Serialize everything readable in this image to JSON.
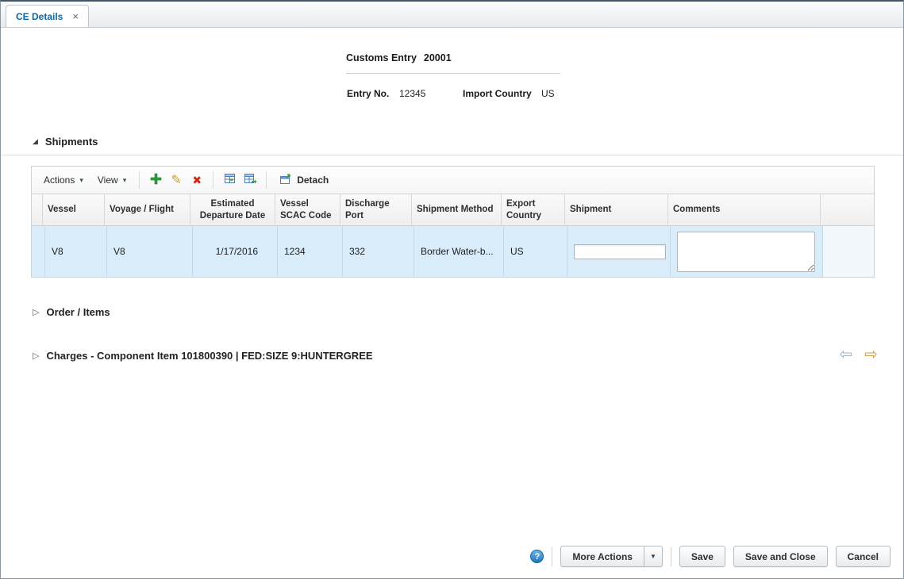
{
  "tab_bar": {
    "active_tab": {
      "label": "CE Details"
    }
  },
  "icons": {
    "tab_close": "×",
    "caret_down": "▾",
    "menu_caret": "▼",
    "expanded_triangle": "◢",
    "collapsed_triangle": "▷",
    "pencil": "✎",
    "delete_x": "✖",
    "prev_arrow": "⇦",
    "next_arrow": "⇨",
    "help": "?"
  },
  "header": {
    "title_label": "Customs Entry",
    "title_value": "20001",
    "entry_no_label": "Entry No.",
    "entry_no_value": "12345",
    "import_country_label": "Import Country",
    "import_country_value": "US"
  },
  "shipments": {
    "title": "Shipments",
    "toolbar": {
      "actions": "Actions",
      "view": "View",
      "detach": "Detach"
    },
    "columns": [
      "Vessel",
      "Voyage / Flight",
      "Estimated Departure Date",
      "Vessel SCAC Code",
      "Discharge Port",
      "Shipment Method",
      "Export Country",
      "Shipment",
      "Comments"
    ],
    "row": {
      "vessel": "V8",
      "voyage_flight": "V8",
      "estimated_departure_date": "1/17/2016",
      "vessel_scac_code": "1234",
      "discharge_port": "332",
      "shipment_method": "Border Water-b...",
      "export_country": "US",
      "shipment_value": "",
      "comments_value": ""
    }
  },
  "sections": {
    "order_items_title": "Order / Items",
    "charges_title": "Charges - Component Item 101800390 | FED:SIZE 9:HUNTERGREE"
  },
  "footer": {
    "more_actions": "More Actions",
    "save": "Save",
    "save_and_close": "Save and Close",
    "cancel": "Cancel"
  },
  "colors": {
    "tab_text": "#0a67ab",
    "row_highlight": "#d9ecfa",
    "add_icon_green": "#2e9e3f",
    "delete_icon_red": "#d3271c"
  }
}
